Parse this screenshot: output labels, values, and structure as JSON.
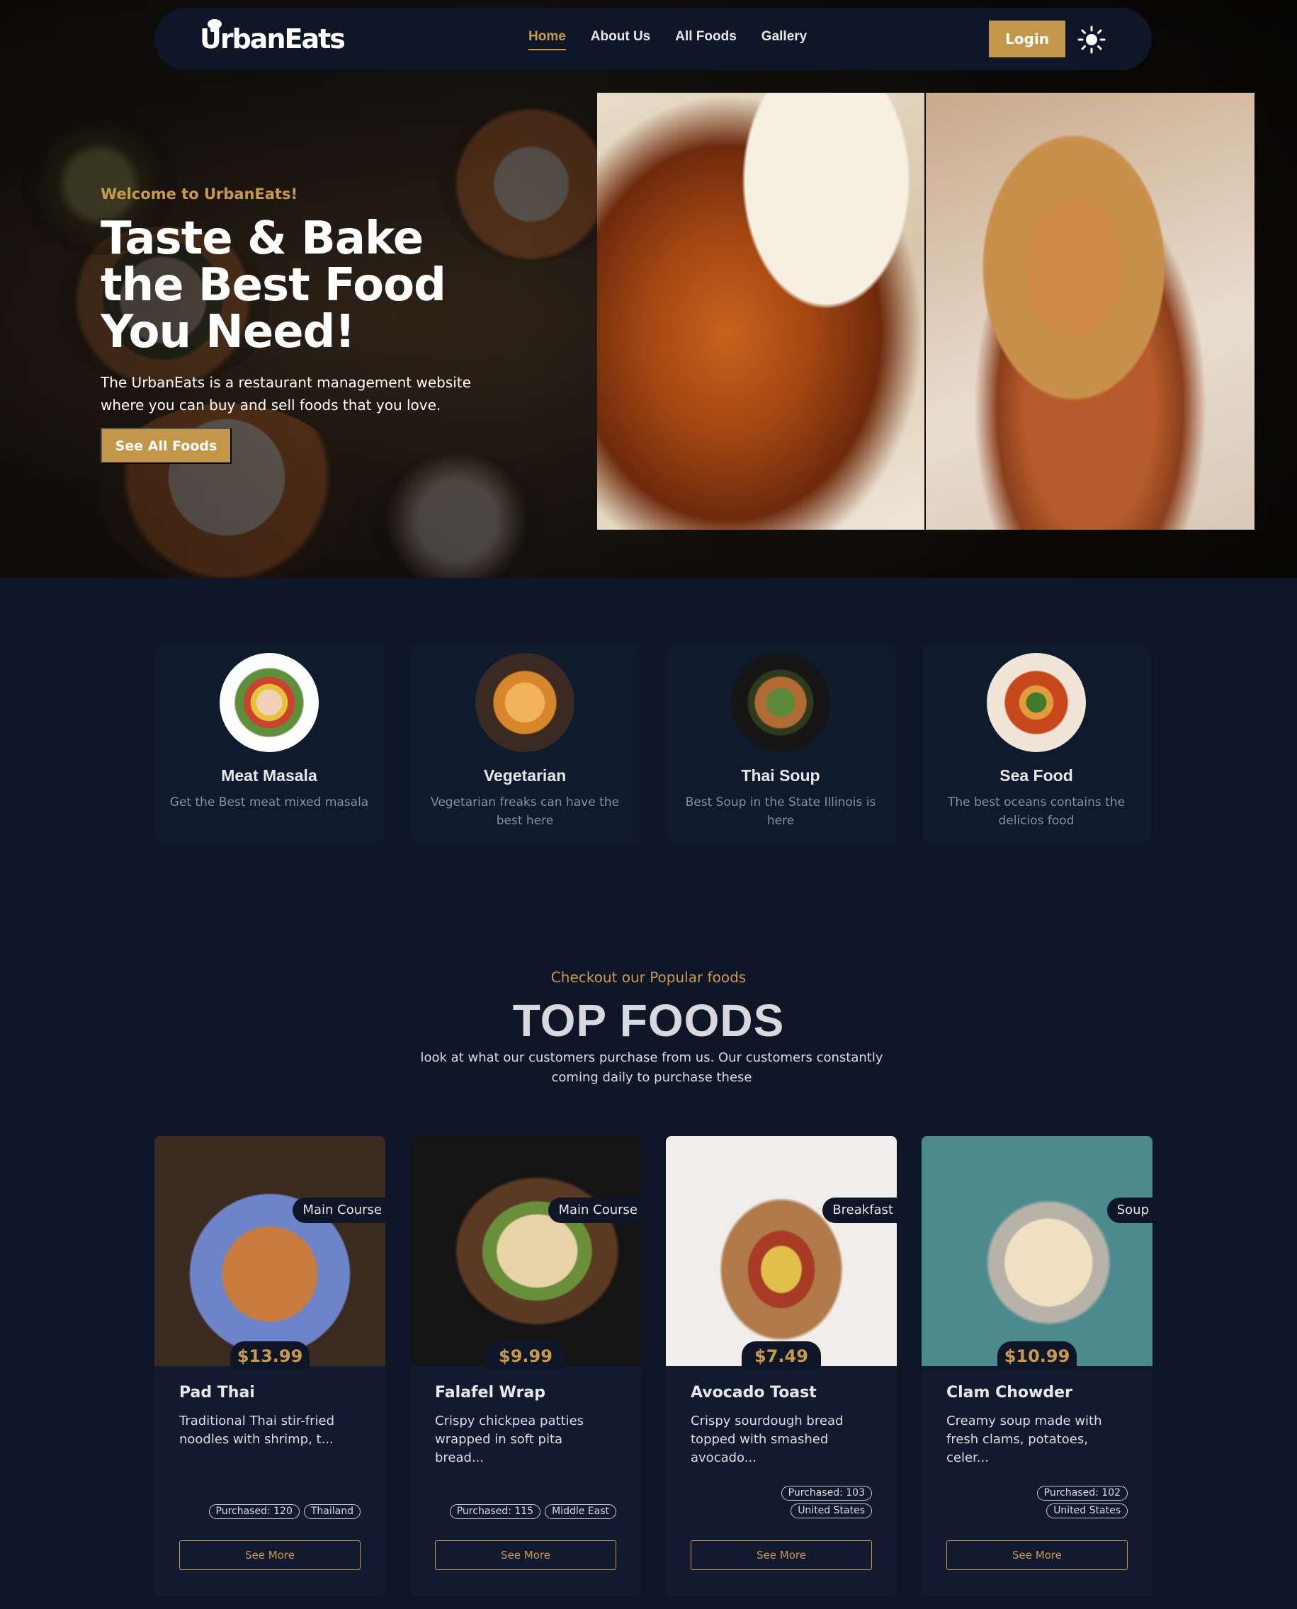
{
  "nav": {
    "logo": "UrbanEats",
    "links": [
      {
        "label": "Home",
        "active": true
      },
      {
        "label": "About Us",
        "active": false
      },
      {
        "label": "All Foods",
        "active": false
      },
      {
        "label": "Gallery",
        "active": false
      }
    ],
    "login_label": "Login",
    "theme_icon": "sun-icon"
  },
  "hero": {
    "welcome": "Welcome to UrbanEats!",
    "headline_lines": [
      "Taste & Bake",
      "the Best Food",
      "You Need!"
    ],
    "description": "The UrbanEats is a restaurant management website where you can buy and sell foods that you love.",
    "cta_label": "See All Foods"
  },
  "categories": [
    {
      "title": "Meat Masala",
      "description": "Get the Best meat mixed masala"
    },
    {
      "title": "Vegetarian",
      "description": "Vegetarian freaks can have the best here"
    },
    {
      "title": "Thai Soup",
      "description": "Best Soup in the State Illinois is here"
    },
    {
      "title": "Sea Food",
      "description": "The best oceans contains the delicios food"
    }
  ],
  "top_foods": {
    "subtitle": "Checkout our Popular foods",
    "title": "TOP FOODS",
    "description": "look at what our customers purchase from us. Our customers constantly coming daily to purchase these",
    "items": [
      {
        "category": "Main Course",
        "price": "$13.99",
        "name": "Pad Thai",
        "description": "Traditional Thai stir-fried noodles with shrimp, t...",
        "purchased": "Purchased: 120",
        "origin": "Thailand",
        "button": "See More"
      },
      {
        "category": "Main Course",
        "price": "$9.99",
        "name": "Falafel Wrap",
        "description": "Crispy chickpea patties wrapped in soft pita bread...",
        "purchased": "Purchased: 115",
        "origin": "Middle East",
        "button": "See More"
      },
      {
        "category": "Breakfast",
        "price": "$7.49",
        "name": "Avocado Toast",
        "description": "Crispy sourdough bread topped with smashed avocado...",
        "purchased": "Purchased: 103",
        "origin": "United States",
        "button": "See More"
      },
      {
        "category": "Soup",
        "price": "$10.99",
        "name": "Clam Chowder",
        "description": "Creamy soup made with fresh clams, potatoes, celer...",
        "purchased": "Purchased: 102",
        "origin": "United States",
        "button": "See More"
      }
    ]
  },
  "colors": {
    "accent": "#c99a4c",
    "background": "#0e1628",
    "card": "#111a2e"
  }
}
